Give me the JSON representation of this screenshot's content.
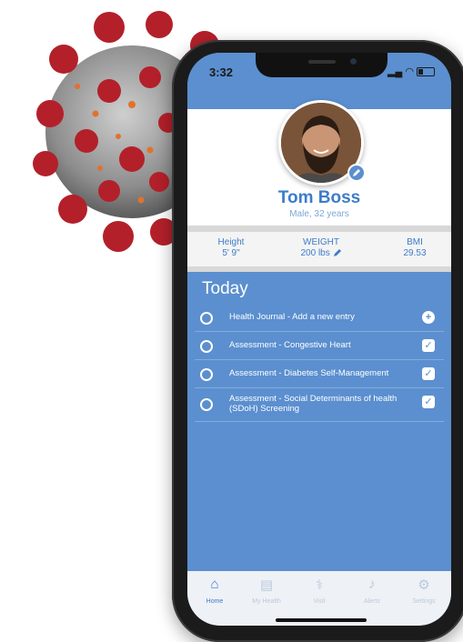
{
  "status": {
    "time": "3:32"
  },
  "profile": {
    "name": "Tom Boss",
    "subtitle": "Male, 32 years"
  },
  "metrics": [
    {
      "label": "Height",
      "value": "5' 9\""
    },
    {
      "label": "WEIGHT",
      "value": "200 lbs"
    },
    {
      "label": "BMI",
      "value": "29.53"
    }
  ],
  "today": {
    "title": "Today",
    "tasks": [
      {
        "label": "Health Journal - Add a new entry",
        "action_icon": "plus-circle-icon"
      },
      {
        "label": "Assessment - Congestive Heart",
        "action_icon": "checkbox-checked-icon"
      },
      {
        "label": "Assessment - Diabetes Self-Management",
        "action_icon": "checkbox-checked-icon"
      },
      {
        "label": "Assessment - Social Determinants of health (SDoH) Screening",
        "action_icon": "checkbox-checked-icon"
      }
    ]
  },
  "tabs": [
    {
      "label": "Home",
      "icon": "home-icon",
      "active": true
    },
    {
      "label": "My Health",
      "icon": "clipboard-icon",
      "active": false
    },
    {
      "label": "Visit",
      "icon": "doctor-icon",
      "active": false
    },
    {
      "label": "Alerts",
      "icon": "bell-icon",
      "active": false
    },
    {
      "label": "Settings",
      "icon": "gear-icon",
      "active": false
    }
  ],
  "colors": {
    "primary": "#5b8fcf",
    "accent": "#3d7cc9"
  }
}
